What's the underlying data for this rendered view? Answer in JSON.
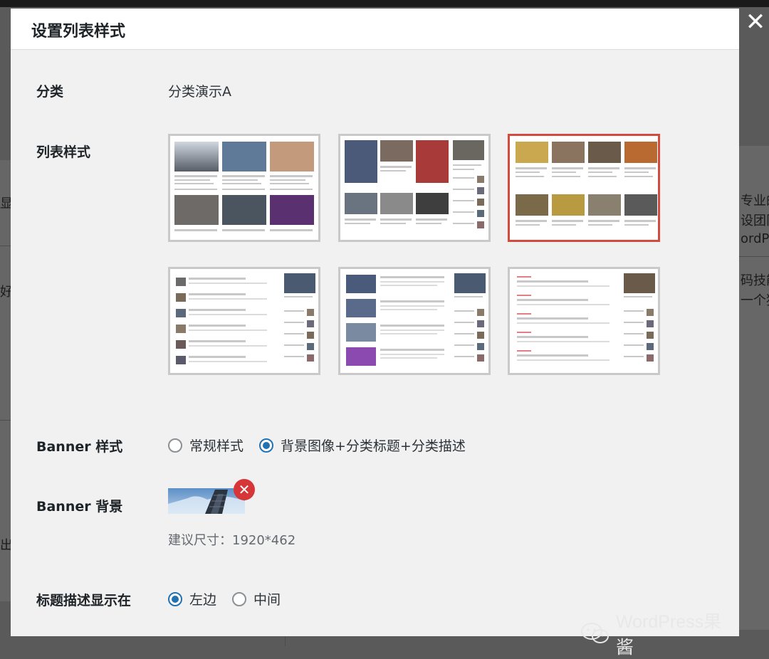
{
  "background": {
    "right_texts": [
      "专业的",
      "设团队",
      "ordPre",
      "码技能",
      "一个独"
    ],
    "left_texts": [
      "显",
      "好",
      "出"
    ]
  },
  "modal": {
    "title": "设置列表样式",
    "close_icon": "close-icon",
    "category": {
      "label": "分类",
      "value": "分类演示A"
    },
    "list_style": {
      "label": "列表样式",
      "options": [
        {
          "name": "grid-3col",
          "selected": false
        },
        {
          "name": "grid-sidebar",
          "selected": false
        },
        {
          "name": "grid-4col",
          "selected": true
        },
        {
          "name": "list-sidebar",
          "selected": false
        },
        {
          "name": "media-list-sidebar",
          "selected": false
        },
        {
          "name": "text-list-sidebar",
          "selected": false
        }
      ]
    },
    "banner_style": {
      "label": "Banner 样式",
      "options": [
        {
          "label": "常规样式",
          "checked": false
        },
        {
          "label": "背景图像+分类标题+分类描述",
          "checked": true
        }
      ]
    },
    "banner_bg": {
      "label": "Banner 背景",
      "hint": "建议尺寸：1920*462",
      "remove_icon": "remove-icon"
    },
    "title_position": {
      "label": "标题描述显示在",
      "options": [
        {
          "label": "左边",
          "checked": true
        },
        {
          "label": "中间",
          "checked": false
        }
      ]
    }
  },
  "watermark": {
    "text": "WordPress果酱"
  },
  "colors": {
    "selected_border": "#d6493d",
    "radio_accent": "#2271b1",
    "remove": "#d63638"
  }
}
